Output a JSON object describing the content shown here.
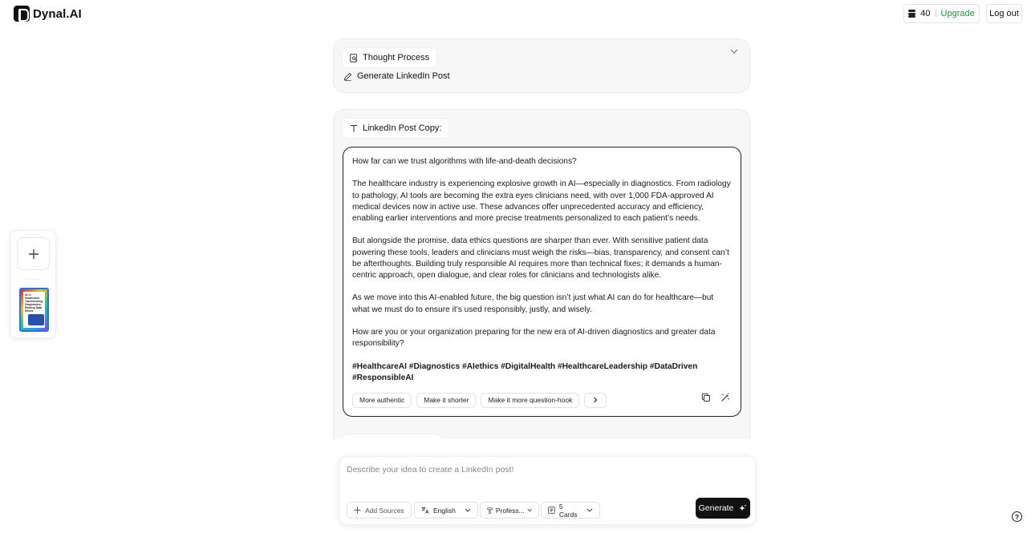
{
  "brand": {
    "name": "Dynal.AI",
    "icon": "dynal-logo-icon"
  },
  "header": {
    "credits": "40",
    "upgrade_label": "Upgrade",
    "logout_label": "Log out",
    "credits_icon": "coins-icon"
  },
  "sidebar": {
    "add_icon": "plus-icon",
    "thumbnail_text": "AI in Healthcare: Transforming Diagnostics, Raising Data Ethics"
  },
  "thought_process": {
    "title": "Thought Process",
    "step_label": "Generate LinkedIn Post",
    "icons": {
      "title": "document-search-icon",
      "step": "pencil-icon",
      "toggle": "chevron-down-icon"
    }
  },
  "post": {
    "section_label": "LinkedIn Post Copy:",
    "section_icon": "text-icon",
    "paragraphs": [
      "How far can we trust algorithms with life-and-death decisions?",
      "The healthcare industry is experiencing explosive growth in AI—especially in diagnostics. From radiology to pathology, AI tools are becoming the extra eyes clinicians need, with over 1,000 FDA-approved AI medical devices now in active use. These advances offer unprecedented accuracy and efficiency, enabling earlier interventions and more precise treatments personalized to each patient’s needs.",
      "But alongside the promise, data ethics questions are sharper than ever. With sensitive patient data powering these tools, leaders and clinicians must weigh the risks—bias, transparency, and consent can’t be afterthoughts. Building truly responsible AI requires more than technical fixes; it demands a human-centric approach, open dialogue, and clear roles for clinicians and technologists alike.",
      "As we move into this AI-enabled future, the big question isn’t just what AI can do for healthcare—but what we must do to ensure it’s used responsibly, justly, and wisely.",
      "How are you or your organization preparing for the new era of AI-driven diagnostics and greater data responsibility?"
    ],
    "hashtags": "#HealthcareAI #Diagnostics #AIethics #DigitalHealth #HealthcareLeadership #DataDriven #ResponsibleAI",
    "actions": [
      "More authentic",
      "Make it shorter",
      "Make it more question-hook"
    ],
    "more_icon": "chevron-right-icon",
    "copy_icon": "copy-icon",
    "magic_icon": "magic-wand-icon"
  },
  "composer": {
    "placeholder": "Describe your idea to create a LinkedIn post!",
    "value": "",
    "add_sources_label": "Add Sources",
    "language": "English",
    "tone": "Profess...",
    "cards": "5 Cards",
    "generate_label": "Generate"
  },
  "help_label": "?"
}
